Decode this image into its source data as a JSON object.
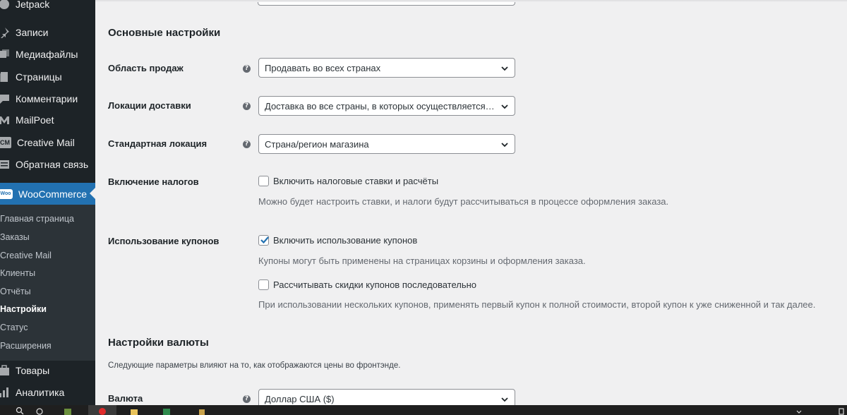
{
  "sidebar": {
    "items": [
      {
        "label": "Jetpack",
        "icon": "jetpack-icon"
      },
      {
        "label": "Записи",
        "icon": "pin-icon"
      },
      {
        "label": "Медиафайлы",
        "icon": "media-icon"
      },
      {
        "label": "Страницы",
        "icon": "page-icon"
      },
      {
        "label": "Комментарии",
        "icon": "comment-icon"
      },
      {
        "label": "MailPoet",
        "icon": "mailpoet-icon"
      },
      {
        "label": "Creative Mail",
        "icon": "creative-mail-icon"
      },
      {
        "label": "Обратная связь",
        "icon": "feedback-icon"
      },
      {
        "label": "WooCommerce",
        "icon": "woo-icon"
      },
      {
        "label": "Товары",
        "icon": "products-icon"
      },
      {
        "label": "Аналитика",
        "icon": "analytics-icon"
      }
    ],
    "woo_icon_text": "Woo",
    "creative_mail_icon_text": "CM",
    "submenu": [
      {
        "label": "Главная страница"
      },
      {
        "label": "Заказы"
      },
      {
        "label": "Creative Mail"
      },
      {
        "label": "Клиенты"
      },
      {
        "label": "Отчёты"
      },
      {
        "label": "Настройки"
      },
      {
        "label": "Статус"
      },
      {
        "label": "Расширения"
      }
    ],
    "active_item": "WooCommerce",
    "current_submenu": "Настройки"
  },
  "general": {
    "title": "Основные настройки",
    "help_glyph": "?",
    "sell_locations": {
      "label": "Область продаж",
      "value": "Продавать во всех странах"
    },
    "ship_locations": {
      "label": "Локации доставки",
      "value": "Доставка во все страны, в которых осуществляется пр..."
    },
    "default_location": {
      "label": "Стандартная локация",
      "value": "Страна/регион магазина"
    },
    "taxes": {
      "label": "Включение налогов",
      "checkbox_label": "Включить налоговые ставки и расчёты",
      "checked": false,
      "description": "Можно будет настроить ставки, и налоги будут рассчитываться в процессе оформления заказа."
    },
    "coupons": {
      "label": "Использование купонов",
      "enable_label": "Включить использование купонов",
      "enable_checked": true,
      "enable_description": "Купоны могут быть применены на страницах корзины и оформления заказа.",
      "sequential_label": "Рассчитывать скидки купонов последовательно",
      "sequential_checked": false,
      "sequential_description": "При использовании нескольких купонов, применять первый купон к полной стоимости, второй купон к уже сниженной и так далее."
    }
  },
  "currency": {
    "title": "Настройки валюты",
    "description": "Следующие параметры влияют на то, как отображаются цены во фронтэнде.",
    "currency_field": {
      "label": "Валюта",
      "value": "Доллар США ($)"
    }
  },
  "colors": {
    "sidebar_bg": "#1d2327",
    "submenu_bg": "#2c3338",
    "accent": "#2271b1",
    "content_bg": "#f0f0f1"
  }
}
